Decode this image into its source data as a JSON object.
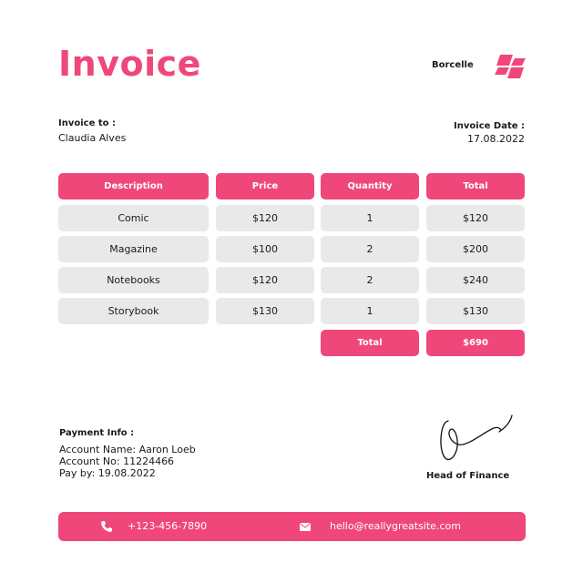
{
  "header": {
    "title": "Invoice",
    "brand": "Borcelle"
  },
  "bill_to": {
    "label": "Invoice to :",
    "name": "Claudia Alves"
  },
  "invoice_date": {
    "label": "Invoice Date :",
    "value": "17.08.2022"
  },
  "table": {
    "columns": [
      "Description",
      "Price",
      "Quantity",
      "Total"
    ],
    "rows": [
      [
        "Comic",
        "$120",
        "1",
        "$120"
      ],
      [
        "Magazine",
        "$100",
        "2",
        "$200"
      ],
      [
        "Notebooks",
        "$120",
        "2",
        "$240"
      ],
      [
        "Storybook",
        "$130",
        "1",
        "$130"
      ]
    ],
    "total_label": "Total",
    "total_value": "$690"
  },
  "payment": {
    "label": "Payment Info :",
    "account_name": "Account Name: Aaron Loeb",
    "account_no": "Account No: 11224466",
    "pay_by": "Pay by: 19.08.2022"
  },
  "signature": {
    "title": "Head of Finance"
  },
  "footer": {
    "phone": "+123-456-7890",
    "email": "hello@reallygreatsite.com"
  },
  "colors": {
    "accent": "#f0477a",
    "row_background": "#e9e9e9"
  },
  "icons": {
    "logo": "stacked-parallelograms-logo",
    "phone": "phone-icon",
    "email": "envelope-icon"
  }
}
